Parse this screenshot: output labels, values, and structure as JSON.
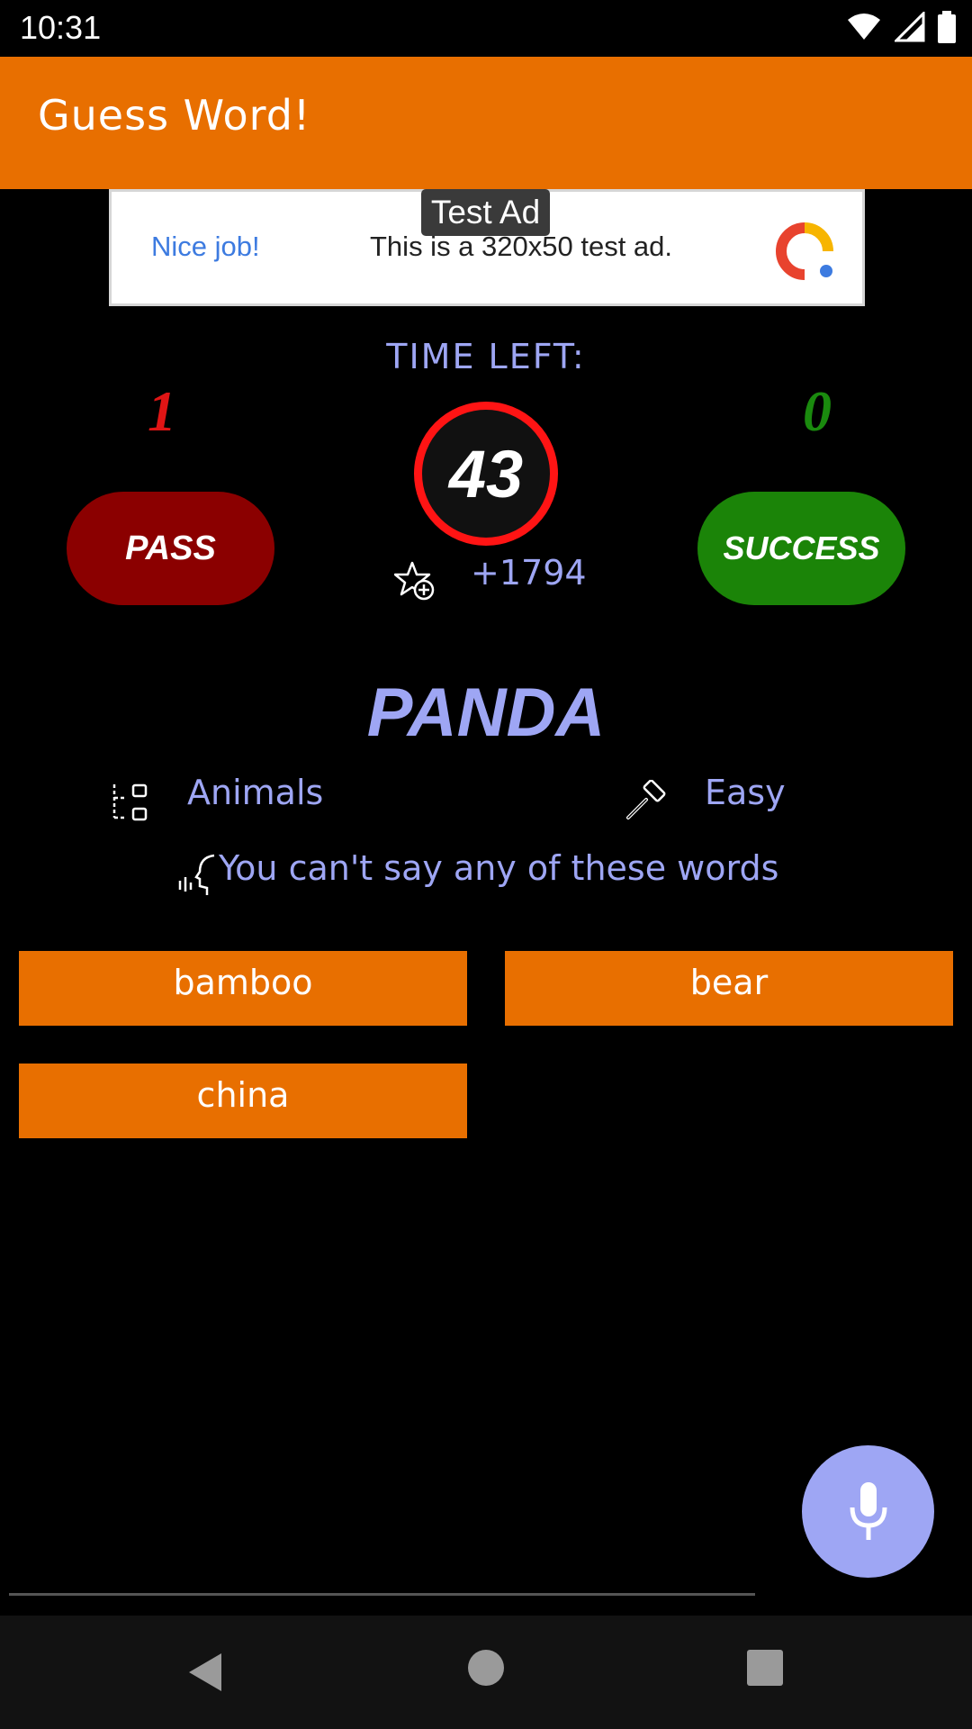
{
  "status_bar": {
    "time": "10:31",
    "icons": [
      "wifi-icon",
      "signal-icon",
      "battery-icon"
    ]
  },
  "app_bar": {
    "title": "Guess Word!",
    "color": "#E86F00"
  },
  "ad": {
    "tag": "Test Ad",
    "headline": "Nice job!",
    "text": "This is a 320x50 test ad."
  },
  "game": {
    "time_label": "TIME LEFT:",
    "time_left": "43",
    "pass_count": "1",
    "success_count": "0",
    "pass_label": "PASS",
    "success_label": "SUCCESS",
    "bonus_points": "+1794",
    "word": "PANDA",
    "category": "Animals",
    "difficulty": "Easy",
    "taboo_label": "You can't say any of these words",
    "taboo_words": [
      "bamboo",
      "bear",
      "china"
    ]
  },
  "colors": {
    "accent": "#9EA6F4",
    "pass": "#8B0000",
    "pass_count": "#E01515",
    "success": "#1B8408",
    "timer_ring": "#FF1414"
  },
  "icons": {
    "bonus": "star-plus-icon",
    "category": "category-icon",
    "difficulty": "hammer-icon",
    "taboo": "speaking-head-icon",
    "mic": "microphone-icon"
  },
  "nav": [
    "back",
    "home",
    "recents"
  ]
}
